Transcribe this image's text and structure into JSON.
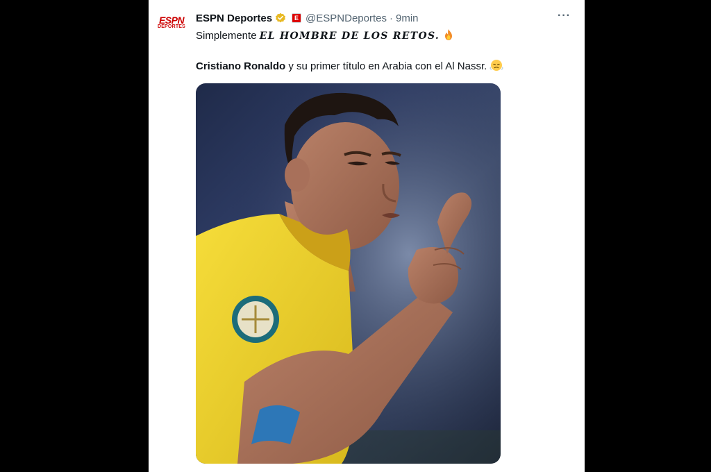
{
  "tweet": {
    "display_name": "ESPN Deportes",
    "handle": "@ESPNDeportes",
    "separator": "·",
    "time": "9min",
    "more_label": "···",
    "avatar_top": "ESPN",
    "avatar_bottom": "DEPORTES",
    "affiliate_badge": "E",
    "line1_prefix": "Simplemente",
    "line1_styled": "EL HOMBRE DE LOS RETOS.",
    "line2_bold": "Cristiano Ronaldo",
    "line2_rest": "y su primer título en Arabia con el Al Nassr."
  },
  "colors": {
    "verified": "#e8b923",
    "jersey": "#f4d830",
    "brand": "#cc0000"
  },
  "icons": {
    "verified": "gold-verified-badge-icon",
    "fire": "fire-emoji-icon",
    "face": "steam-face-emoji-icon"
  }
}
